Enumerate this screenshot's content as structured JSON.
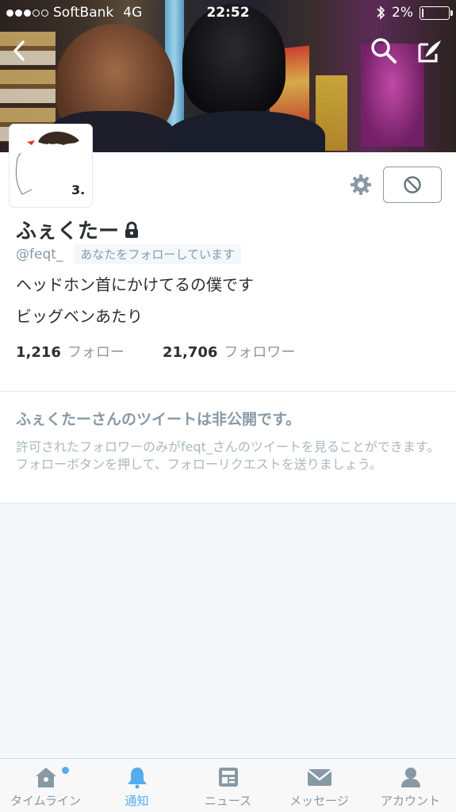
{
  "status_bar": {
    "carrier": "SoftBank",
    "network": "4G",
    "time": "22:52",
    "battery": "2%",
    "battery_level": 0.02,
    "signal_bars": 3
  },
  "profile": {
    "name": "ふぇくたー",
    "handle": "@feqt_",
    "follows_you": "あなたをフォローしています",
    "bio_line1": "ヘッドホン首にかけてるの僕です",
    "bio_line2": "ビッグベンあたり",
    "following_count": "1,216",
    "following_label": "フォロー",
    "followers_count": "21,706",
    "followers_label": "フォロワー"
  },
  "protected_notice": {
    "title": "ふぇくたーさんのツイートは非公開です。",
    "body": "許可されたフォロワーのみがfeqt_さんのツイートを見ることができます。フォローボタンを押して、フォローリクエストを送りましょう。"
  },
  "tabs": [
    {
      "label": "タイムライン",
      "icon": "home-icon",
      "active": false,
      "badge": true
    },
    {
      "label": "通知",
      "icon": "bell-icon",
      "active": true
    },
    {
      "label": "ニュース",
      "icon": "news-icon",
      "active": false
    },
    {
      "label": "メッセージ",
      "icon": "envelope-icon",
      "active": false
    },
    {
      "label": "アカウント",
      "icon": "person-icon",
      "active": false
    }
  ],
  "colors": {
    "accent": "#55acee",
    "muted": "#8899a6",
    "text": "#292f33"
  }
}
